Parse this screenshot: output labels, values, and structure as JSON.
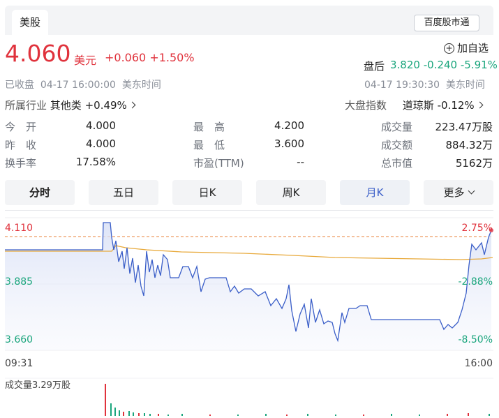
{
  "tabs": {
    "active": "美股"
  },
  "hk_connect": "百度股市通",
  "quote": {
    "price": "4.060",
    "currency": "美元",
    "change": "+0.060",
    "change_pct": "+1.50%",
    "status": "已收盘",
    "datetime": "04-17 16:00:00",
    "timezone": "美东时间",
    "add_watch": "加自选",
    "after_hours_label": "盘后",
    "after_hours_price": "3.820",
    "after_hours_change": "-0.240",
    "after_hours_pct": "-5.91%",
    "after_hours_time": "04-17 19:30:30",
    "after_hours_tz": "美东时间"
  },
  "industry": {
    "label": "所属行业",
    "name": "其他类",
    "change": "+0.49%"
  },
  "market_index": {
    "label": "大盘指数",
    "name": "道琼斯",
    "change": "-0.12%"
  },
  "stats": {
    "open_label": "今　开",
    "open": "4.000",
    "high_label": "最　高",
    "high": "4.200",
    "volume_label": "成交量",
    "volume": "223.47万股",
    "prev_label": "昨　收",
    "prev": "4.000",
    "low_label": "最　低",
    "low": "3.600",
    "amount_label": "成交额",
    "amount": "884.32万",
    "turnover_label": "换手率",
    "turnover": "17.58%",
    "pe_label": "市盈(TTM)",
    "pe": "--",
    "mktcap_label": "总市值",
    "mktcap": "5162万"
  },
  "periods": [
    "分时",
    "五日",
    "日K",
    "周K",
    "月K",
    "更多"
  ],
  "period_active": "分时",
  "chart": {
    "y_top": "4.110",
    "y_mid": "3.885",
    "y_bot": "3.660",
    "pct_top": "2.75%",
    "pct_mid": "-2.88%",
    "pct_bot": "-8.50%",
    "x_start": "09:31",
    "x_end": "16:00",
    "volume_label": "成交量3.29万股"
  },
  "colors": {
    "up": "#e0323c",
    "down": "#1aa57c",
    "price_line": "#3a5ec8",
    "avg_line": "#e8a93a"
  }
}
